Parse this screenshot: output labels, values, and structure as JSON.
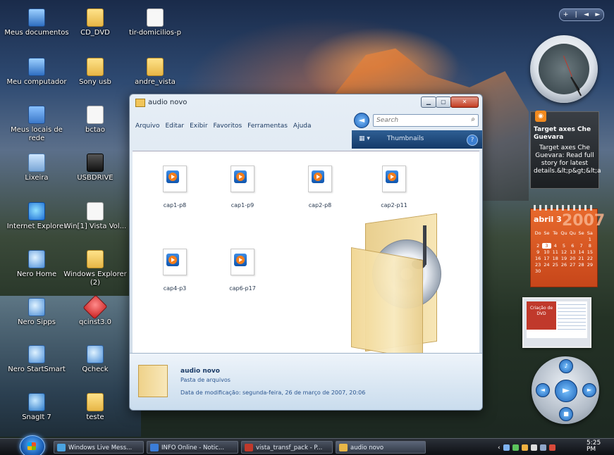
{
  "desktop": {
    "icons": [
      {
        "label": "Meus documentos",
        "icon": "documents-icon"
      },
      {
        "label": "CD_DVD",
        "icon": "folder-icon"
      },
      {
        "label": "tir-domicilios-p",
        "icon": "document-icon"
      },
      {
        "label": "Meu computador",
        "icon": "computer-icon"
      },
      {
        "label": "Sony usb",
        "icon": "folder-icon"
      },
      {
        "label": "andre_vista",
        "icon": "folder-icon"
      },
      {
        "label": "Meus locais de rede",
        "icon": "network-icon"
      },
      {
        "label": "bctao",
        "icon": "document-icon"
      },
      {
        "label": "Lixeira",
        "icon": "recycle-bin-icon"
      },
      {
        "label": "USBDRIVE",
        "icon": "drive-icon"
      },
      {
        "label": "Internet Explorer",
        "icon": "internet-explorer-icon"
      },
      {
        "label": "Win[1] Vista Vol...",
        "icon": "document-icon"
      },
      {
        "label": "Nero Home",
        "icon": "nero-icon"
      },
      {
        "label": "Windows Explorer (2)",
        "icon": "folder-icon"
      },
      {
        "label": "Nero Sipps",
        "icon": "nero-icon"
      },
      {
        "label": "qcinst3.0",
        "icon": "installer-icon"
      },
      {
        "label": "Nero StartSmart",
        "icon": "nero-icon"
      },
      {
        "label": "Qcheck",
        "icon": "nero-icon"
      },
      {
        "label": "SnagIt 7",
        "icon": "snagit-icon"
      },
      {
        "label": "teste",
        "icon": "folder-icon"
      }
    ]
  },
  "sidebar": {
    "controls": [
      "+",
      "|",
      "◄",
      "►"
    ],
    "feed": {
      "title": "Target axes Che Guevara",
      "body": "Target axes Che Guevara: Read full story for latest details.&lt;p&gt;&lt;a"
    },
    "calendar": {
      "month": "abril 3",
      "year": "2007",
      "weekdays": [
        "Do",
        "Se",
        "Te",
        "Qu",
        "Qu",
        "Se",
        "Sa"
      ],
      "days": [
        "",
        "",
        "",
        "",
        "",
        "",
        "1",
        "2",
        "3",
        "4",
        "5",
        "6",
        "7",
        "8",
        "9",
        "10",
        "11",
        "12",
        "13",
        "14",
        "15",
        "16",
        "17",
        "18",
        "19",
        "20",
        "21",
        "22",
        "23",
        "24",
        "25",
        "26",
        "27",
        "28",
        "29",
        "30"
      ],
      "today": "3"
    },
    "slideshow": {
      "caption": "Criação de DVD"
    }
  },
  "window": {
    "title": "audio novo",
    "menu": [
      "Arquivo",
      "Editar",
      "Exibir",
      "Favoritos",
      "Ferramentas",
      "Ajuda"
    ],
    "search_placeholder": "Search",
    "toolbar": {
      "views": "▦ ▾",
      "thumbnails": "Thumbnails"
    },
    "files": [
      {
        "name": "cap1-p8"
      },
      {
        "name": "cap1-p9"
      },
      {
        "name": "cap2-p8"
      },
      {
        "name": "cap2-p11"
      },
      {
        "name": "cap4-p3"
      },
      {
        "name": "cap6-p17"
      }
    ],
    "details": {
      "name": "audio novo",
      "type": "Pasta de arquivos",
      "modified": "Data de modificação: segunda-feira, 26 de março de 2007, 20:06"
    }
  },
  "taskbar": {
    "tasks": [
      {
        "label": "Windows Live Mess...",
        "color": "#4aa3e0"
      },
      {
        "label": "INFO Online - Notic...",
        "color": "#3b7dd8"
      },
      {
        "label": "vista_transf_pack - P...",
        "color": "#c0392b"
      },
      {
        "label": "audio novo",
        "color": "#e7b647"
      }
    ],
    "tray": [
      "‹",
      "•",
      "•",
      "•",
      "•",
      "•",
      "•"
    ],
    "time": "5:25",
    "period": "PM"
  }
}
